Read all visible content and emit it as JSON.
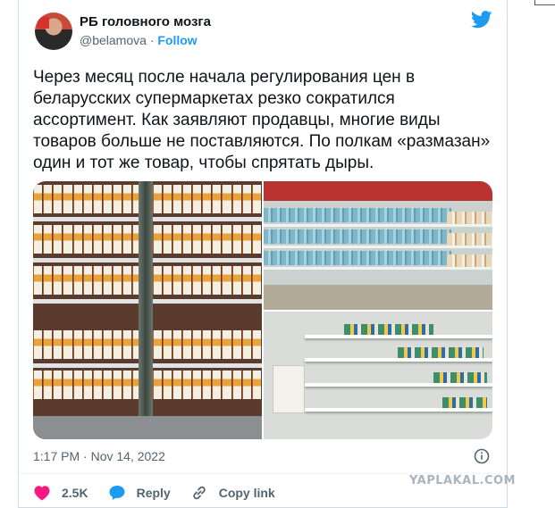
{
  "tweet": {
    "author_name": "РБ головного мозга",
    "handle": "@belamova",
    "separator": "·",
    "follow_label": "Follow",
    "text": "Через месяц после начала регулирования цен в беларусских супермаркетах резко сократился ассортимент. Как заявляют продавцы, многие виды товаров больше не поставляются. По полкам «размазан» один и тот же товар, чтобы спрятать дыры.",
    "timestamp": "1:17 PM · Nov 14, 2022"
  },
  "actions": {
    "likes_count": "2.5K",
    "reply_label": "Reply",
    "copy_link_label": "Copy link"
  },
  "watermark": "YAPLAKAL.COM",
  "colors": {
    "like": "#f91880",
    "accent": "#1d9bf0",
    "muted": "#536471"
  },
  "icons": [
    "twitter-bird-icon",
    "info-icon",
    "heart-icon",
    "reply-bubble-icon",
    "link-icon"
  ],
  "photos": [
    "juice-shelves-photo",
    "refrigerated-section-photo",
    "empty-shelves-photo"
  ]
}
